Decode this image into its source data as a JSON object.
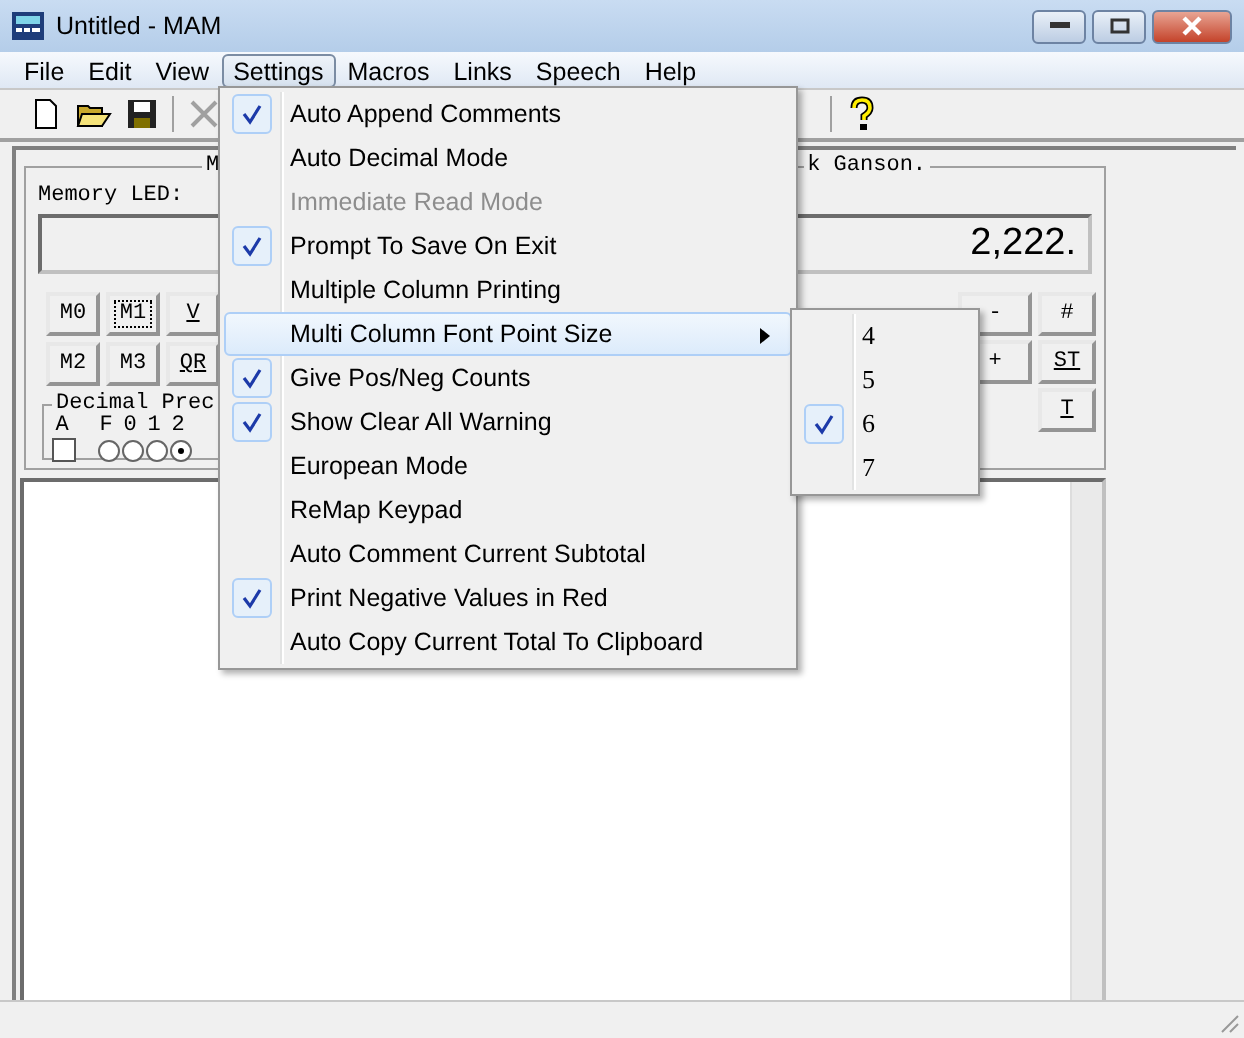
{
  "window": {
    "title": "Untitled - MAM"
  },
  "menu_bar": [
    {
      "label": "File",
      "selected": false
    },
    {
      "label": "Edit",
      "selected": false
    },
    {
      "label": "View",
      "selected": false
    },
    {
      "label": "Settings",
      "selected": true
    },
    {
      "label": "Macros",
      "selected": false
    },
    {
      "label": "Links",
      "selected": false
    },
    {
      "label": "Speech",
      "selected": false
    },
    {
      "label": "Help",
      "selected": false
    }
  ],
  "group": {
    "title_fragments": [
      "M",
      "k Ganson."
    ],
    "memory_led_label": "Memory LED:",
    "display": "2,222.",
    "memory_keys": [
      {
        "label": "M0",
        "focused": false,
        "underlined": false
      },
      {
        "label": "M1",
        "focused": true,
        "underlined": false
      },
      {
        "label": "V",
        "focused": false,
        "underlined": true
      },
      {
        "label": "M2",
        "focused": false,
        "underlined": false
      },
      {
        "label": "M3",
        "focused": false,
        "underlined": false
      },
      {
        "label": "QR",
        "focused": false,
        "underlined": true
      }
    ],
    "right_keys": [
      {
        "label": "-",
        "underlined": false
      },
      {
        "label": "#",
        "underlined": false
      },
      {
        "label": "+",
        "underlined": false
      },
      {
        "label": "ST",
        "underlined": true
      },
      {
        "label": "T",
        "underlined": true
      }
    ],
    "decimal": {
      "title": "Decimal Prec",
      "auto_label": "A",
      "auto_checked": false,
      "options": [
        {
          "label": "F",
          "selected": false
        },
        {
          "label": "0",
          "selected": false
        },
        {
          "label": "1",
          "selected": false
        },
        {
          "label": "2",
          "selected": true
        }
      ]
    }
  },
  "settings_menu": [
    {
      "label": "Auto Append Comments",
      "checked": true,
      "disabled": false,
      "selected": false,
      "submenu": false
    },
    {
      "label": "Auto Decimal Mode",
      "checked": false,
      "disabled": false,
      "selected": false,
      "submenu": false
    },
    {
      "label": "Immediate Read Mode",
      "checked": false,
      "disabled": true,
      "selected": false,
      "submenu": false
    },
    {
      "label": "Prompt To Save On Exit",
      "checked": true,
      "disabled": false,
      "selected": false,
      "submenu": false
    },
    {
      "label": "Multiple Column Printing",
      "checked": false,
      "disabled": false,
      "selected": false,
      "submenu": false
    },
    {
      "label": "Multi Column Font Point Size",
      "checked": false,
      "disabled": false,
      "selected": true,
      "submenu": true
    },
    {
      "label": "Give Pos/Neg Counts",
      "checked": true,
      "disabled": false,
      "selected": false,
      "submenu": false
    },
    {
      "label": "Show Clear All Warning",
      "checked": true,
      "disabled": false,
      "selected": false,
      "submenu": false
    },
    {
      "label": "European Mode",
      "checked": false,
      "disabled": false,
      "selected": false,
      "submenu": false
    },
    {
      "label": "ReMap Keypad",
      "checked": false,
      "disabled": false,
      "selected": false,
      "submenu": false
    },
    {
      "label": "Auto Comment Current Subtotal",
      "checked": false,
      "disabled": false,
      "selected": false,
      "submenu": false
    },
    {
      "label": "Print Negative Values in Red",
      "checked": true,
      "disabled": false,
      "selected": false,
      "submenu": false
    },
    {
      "label": "Auto Copy Current Total To Clipboard",
      "checked": false,
      "disabled": false,
      "selected": false,
      "submenu": false
    }
  ],
  "font_size_submenu": [
    {
      "label": "4",
      "checked": false
    },
    {
      "label": "5",
      "checked": false
    },
    {
      "label": "6",
      "checked": true
    },
    {
      "label": "7",
      "checked": false
    }
  ]
}
